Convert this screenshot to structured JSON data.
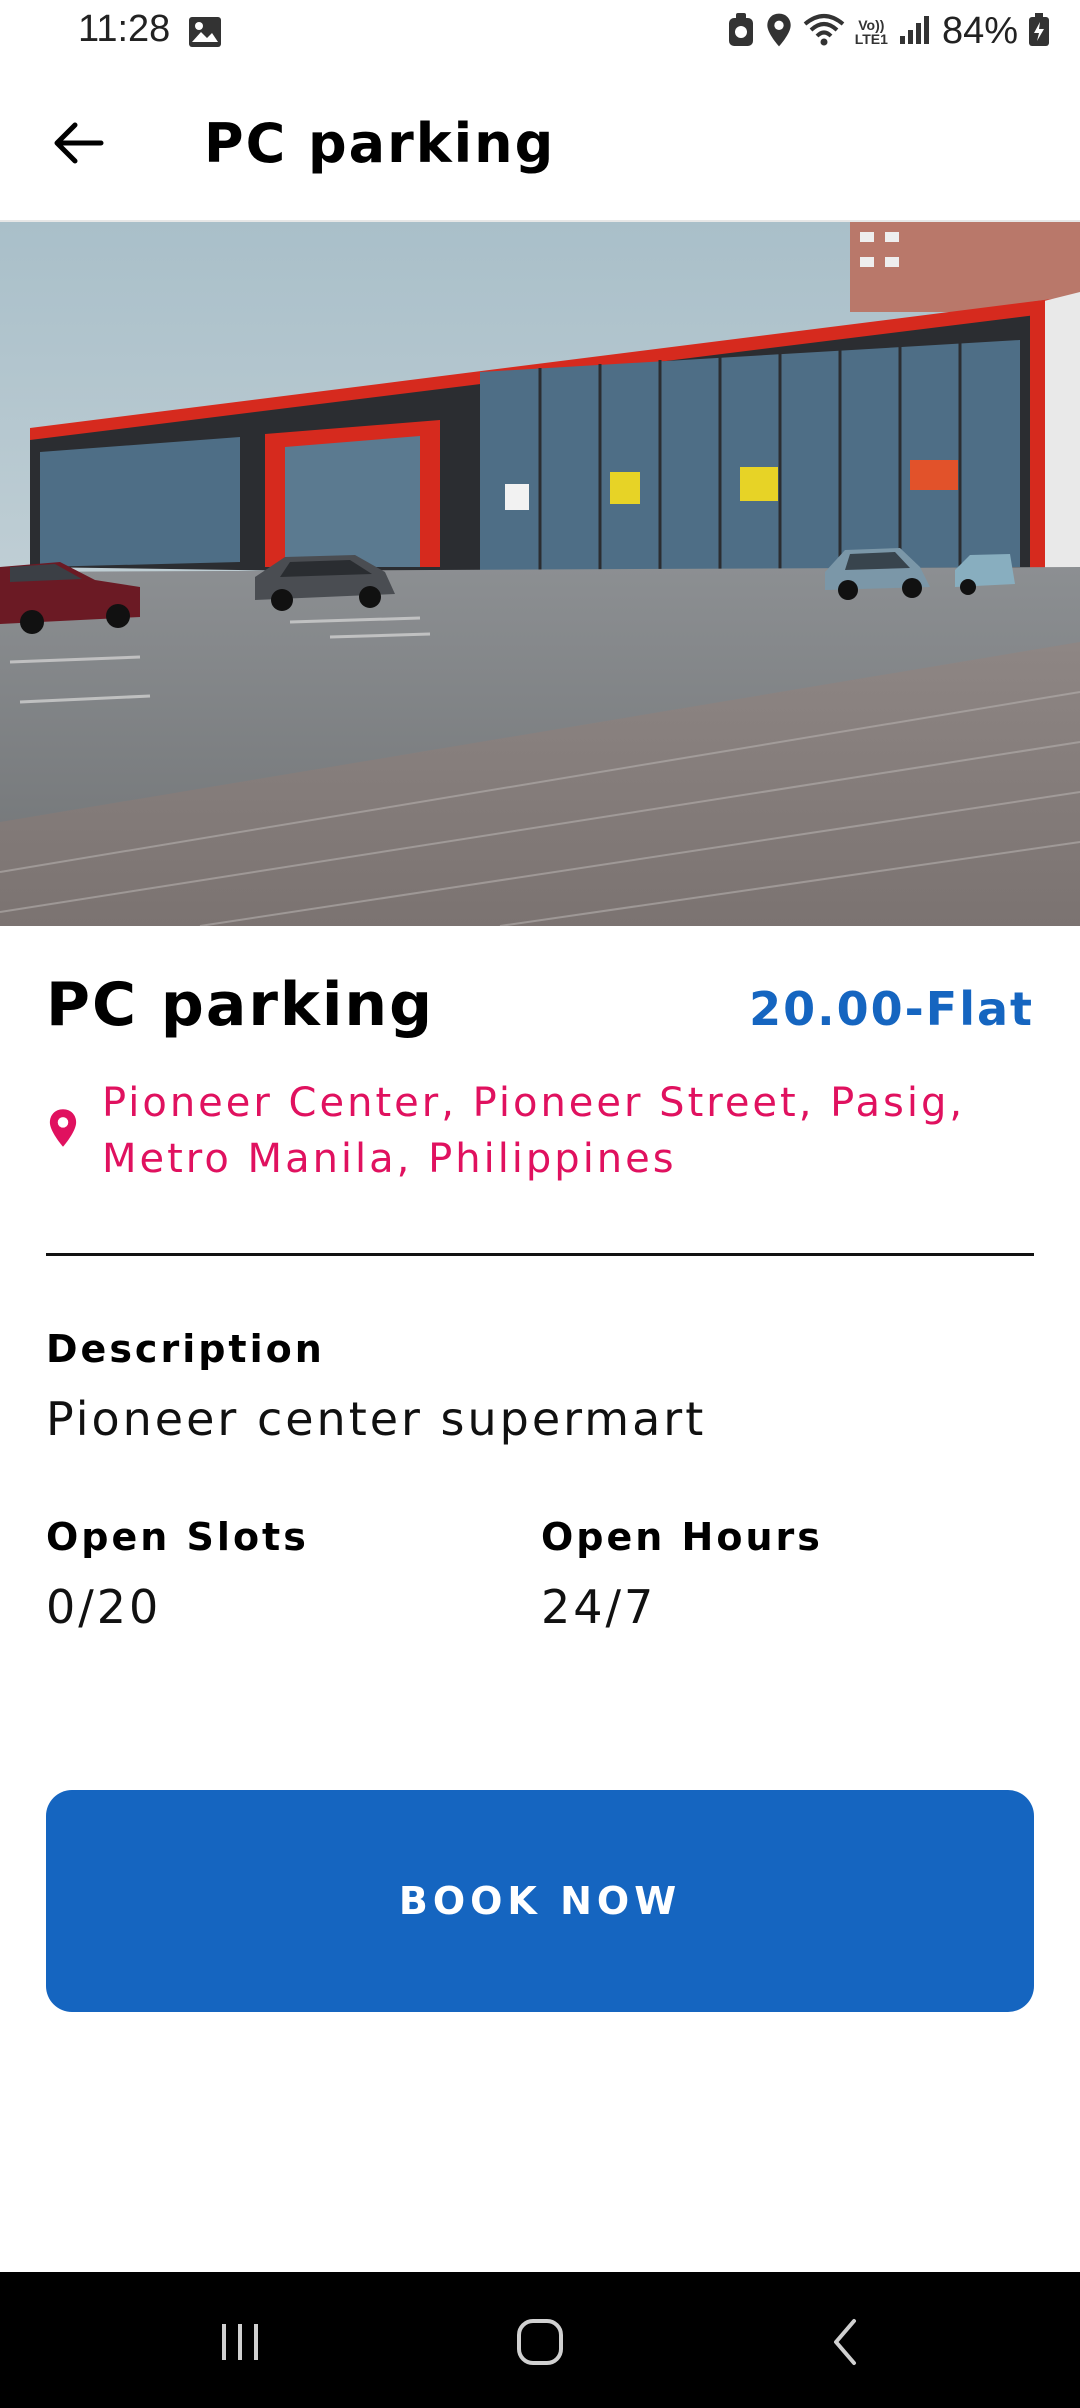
{
  "status_bar": {
    "time": "11:28",
    "battery": "84%",
    "icons": [
      "gallery-icon",
      "lock-icon",
      "location-icon",
      "wifi-icon",
      "volte-icon",
      "signal-icon",
      "battery-icon"
    ],
    "volte_top": "Vo))",
    "volte_bottom": "LTE1"
  },
  "app_bar": {
    "title": "PC parking",
    "back_icon": "arrow-left-icon"
  },
  "place": {
    "name": "PC parking",
    "price": "20.00-Flat",
    "address": "Pioneer Center, Pioneer Street, Pasig, Metro Manila, Philippines",
    "location_icon": "map-pin-icon"
  },
  "details": {
    "description_label": "Description",
    "description_value": "Pioneer center supermart",
    "slots_label": "Open Slots",
    "slots_value": "0/20",
    "hours_label": "Open Hours",
    "hours_value": "24/7"
  },
  "actions": {
    "book_label": "BOOK NOW"
  },
  "nav_bar": {
    "icons": [
      "recent-apps-icon",
      "home-icon",
      "back-icon"
    ]
  },
  "colors": {
    "accent": "#1565c0",
    "address": "#e0115f",
    "nav_background": "#000000"
  }
}
